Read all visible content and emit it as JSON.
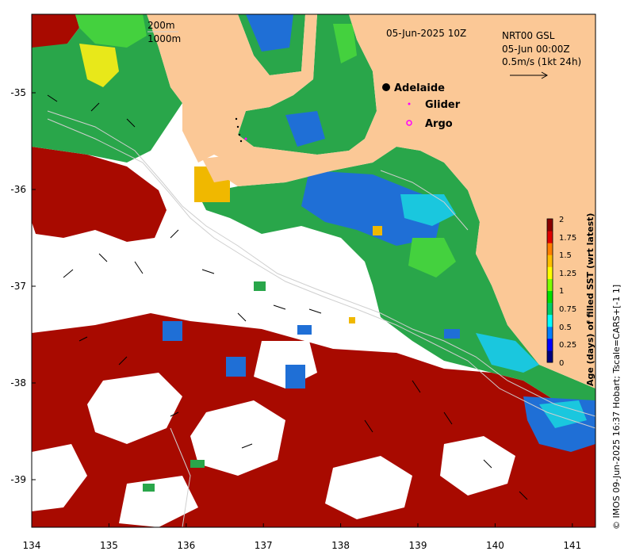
{
  "map": {
    "date_title": "05-Jun-2025 10Z",
    "product": "NRT00 GSL",
    "current_time": "05-Jun 00:00Z",
    "vector_scale": "0.5m/s (1kt 24h)",
    "isobath_shallow": "200m",
    "isobath_deep": "1000m",
    "credit": "© IMOS 09-Jun-2025 16:37 Hobart; Tscale=CARS+[-1 1]",
    "x_ticks": [
      "134",
      "135",
      "136",
      "137",
      "138",
      "139",
      "140",
      "141"
    ],
    "y_ticks": [
      "-35",
      "-36",
      "-37",
      "-38",
      "-39"
    ],
    "lon_range": [
      134,
      141.3
    ],
    "lat_range": [
      -39.5,
      -34.2
    ]
  },
  "legend": {
    "city": {
      "label": "Adelaide",
      "symbol": "filled-circle",
      "color": "#000000"
    },
    "glider": {
      "label": "Glider",
      "symbol": "dot",
      "color": "#ff00ff"
    },
    "argo": {
      "label": "Argo",
      "symbol": "open-circle",
      "color": "#ff00ff"
    }
  },
  "colorbar": {
    "title": "Age (days) of filled SST (wrt latest)",
    "ticks": [
      "0",
      "0.25",
      "0.5",
      "0.75",
      "1",
      "1.25",
      "1.5",
      "1.75",
      "2"
    ],
    "colors": [
      "#00007f",
      "#0000ff",
      "#007fff",
      "#00ffff",
      "#00cc66",
      "#00e000",
      "#7fff00",
      "#ffff00",
      "#ffbf00",
      "#ff7f00",
      "#e00000",
      "#8b0000"
    ]
  },
  "colors": {
    "land": "#fbc896",
    "sst_old": "#a80a00",
    "sst_recent": "#29a64a",
    "sst_green_light": "#44d13e",
    "sst_blue": "#1f6fd6",
    "sst_cyan": "#1ac7de",
    "sst_yellow": "#e8e81a",
    "sst_orange": "#f0b800",
    "current_arrow": "#000000",
    "isobath": "#cfcfcf"
  }
}
